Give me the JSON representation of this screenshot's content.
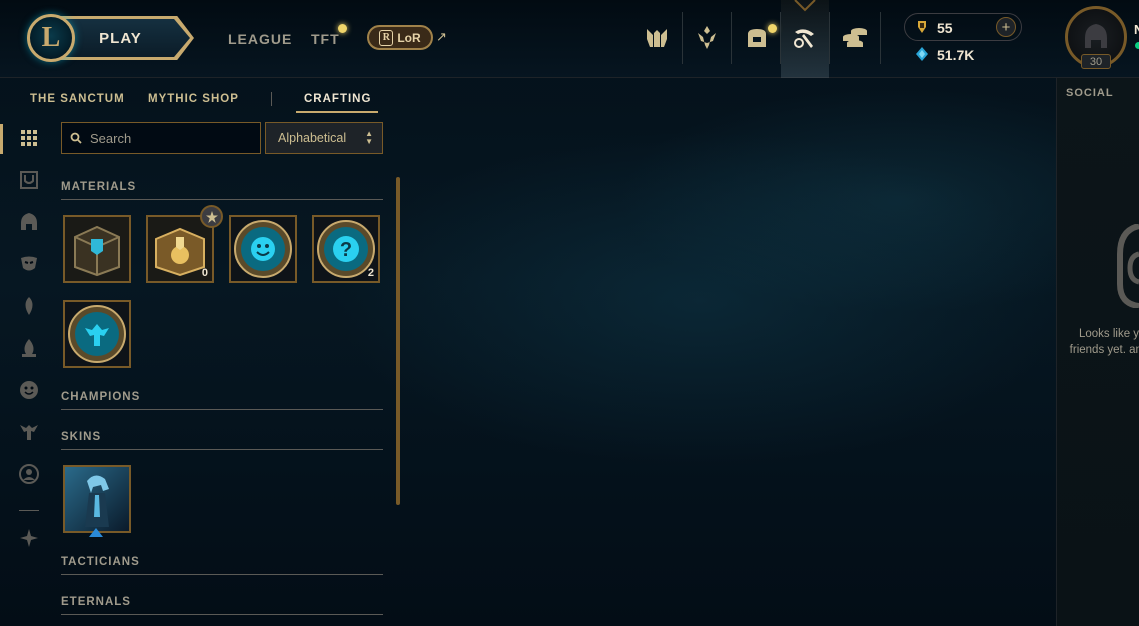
{
  "header": {
    "play_label": "PLAY",
    "nav": [
      {
        "label": "LEAGUE"
      },
      {
        "label": "TFT"
      }
    ],
    "lor_label": "LoR",
    "lor_icon": "R",
    "external_icon": "↗",
    "currencies": {
      "rp": "55",
      "blue_essence": "51.7K"
    },
    "plus_label": "+",
    "summoner_level": "30",
    "summoner_name_initial": "N"
  },
  "subnav": {
    "items": [
      {
        "label": "THE SANCTUM"
      },
      {
        "label": "MYTHIC SHOP"
      },
      {
        "label": "CRAFTING"
      }
    ],
    "active": "CRAFTING"
  },
  "search": {
    "placeholder": "Search",
    "value": ""
  },
  "sort": {
    "selected": "Alphabetical"
  },
  "sections": [
    {
      "title": "MATERIALS"
    },
    {
      "title": "CHAMPIONS"
    },
    {
      "title": "SKINS"
    },
    {
      "title": "TACTICIANS"
    },
    {
      "title": "ETERNALS"
    }
  ],
  "materials": [
    {
      "name": "hextech-chest-icon",
      "count": ""
    },
    {
      "name": "masterwork-chest-icon",
      "count": "0"
    },
    {
      "name": "emote-icon",
      "count": ""
    },
    {
      "name": "mystery-icon",
      "count": "2"
    },
    {
      "name": "ward-icon",
      "count": ""
    }
  ],
  "social": {
    "title": "SOCIAL",
    "empty_text": "Looks like y friends yet. and"
  },
  "colors": {
    "gold": "#c8aa6e",
    "gold_dark": "#785a28",
    "teal": "#0ac8b9",
    "text_gold": "#cdbe91",
    "text_gray": "#a09b8c",
    "bg": "#010a13"
  }
}
